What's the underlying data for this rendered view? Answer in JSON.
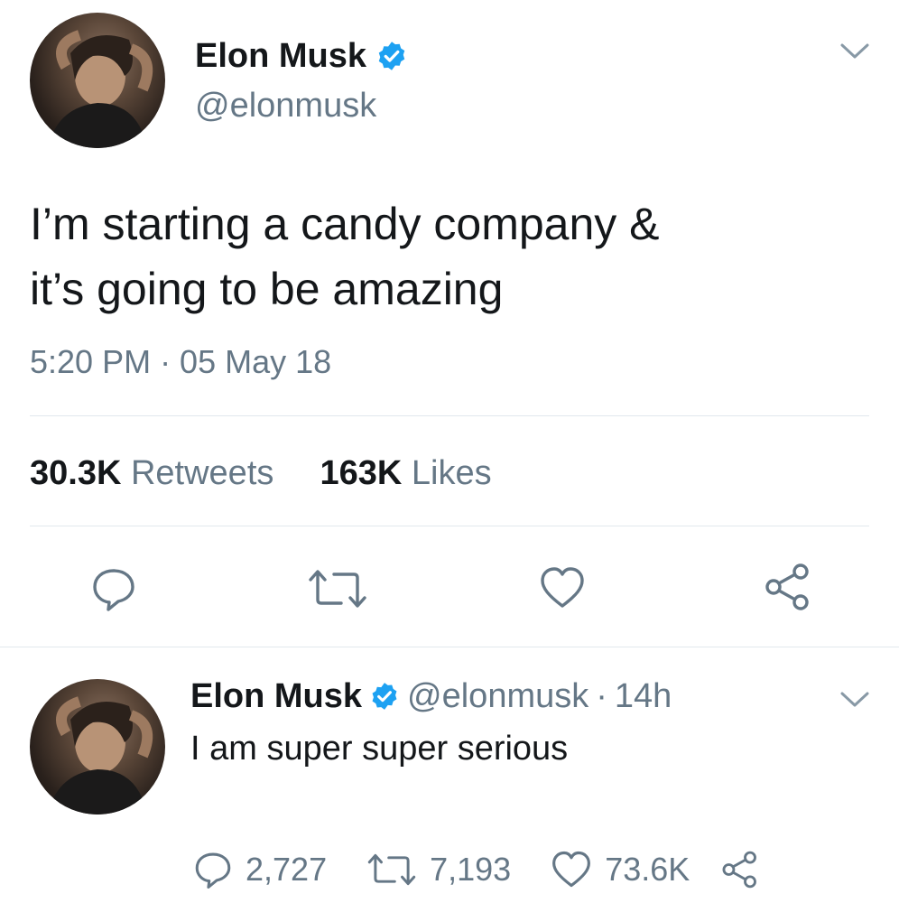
{
  "main_tweet": {
    "author_name": "Elon Musk",
    "author_handle": "@elonmusk",
    "text_line1": "I’m starting a candy company &",
    "text_line2": "it’s going to be amazing",
    "timestamp": "5:20 PM · 05 May 18",
    "retweets_count": "30.3K",
    "retweets_label": "Retweets",
    "likes_count": "163K",
    "likes_label": "Likes"
  },
  "reply_tweet": {
    "author_name": "Elon Musk",
    "author_handle": "@elonmusk",
    "time_sep": "·",
    "time": "14h",
    "text": "I am super super serious",
    "reply_count": "2,727",
    "retweet_count": "7,193",
    "like_count": "73.6K"
  },
  "icons": {
    "verified": "verified-badge-icon",
    "menu": "chevron-down-icon",
    "reply": "reply-icon",
    "retweet": "retweet-icon",
    "like": "heart-icon",
    "share": "share-icon"
  },
  "colors": {
    "text": "#14171a",
    "muted": "#657786",
    "verified": "#1da1f2",
    "divider": "#e1e8ed"
  }
}
